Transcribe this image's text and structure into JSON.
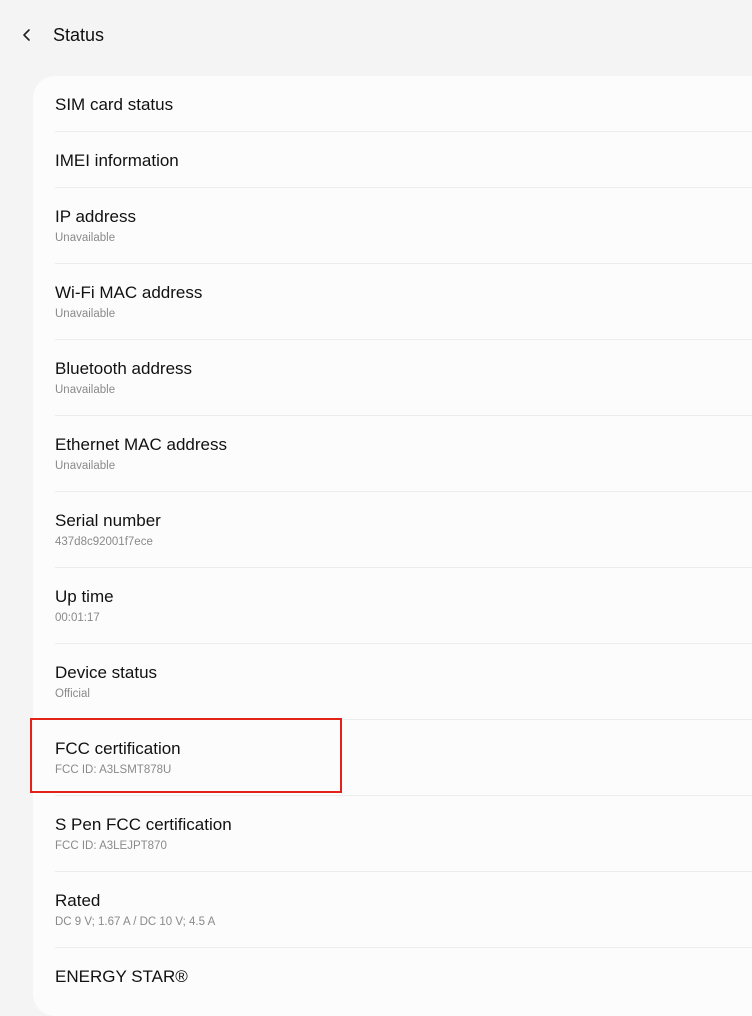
{
  "header": {
    "title": "Status"
  },
  "items": [
    {
      "label": "SIM card status",
      "sub": ""
    },
    {
      "label": "IMEI information",
      "sub": ""
    },
    {
      "label": "IP address",
      "sub": "Unavailable"
    },
    {
      "label": "Wi-Fi MAC address",
      "sub": "Unavailable"
    },
    {
      "label": "Bluetooth address",
      "sub": "Unavailable"
    },
    {
      "label": "Ethernet MAC address",
      "sub": "Unavailable"
    },
    {
      "label": "Serial number",
      "sub": "437d8c92001f7ece"
    },
    {
      "label": "Up time",
      "sub": "00:01:17"
    },
    {
      "label": "Device status",
      "sub": "Official"
    },
    {
      "label": "FCC certification",
      "sub": "FCC ID: A3LSMT878U"
    },
    {
      "label": "S Pen FCC certification",
      "sub": "FCC ID: A3LEJPT870"
    },
    {
      "label": "Rated",
      "sub": "DC 9 V; 1.67 A / DC 10 V; 4.5 A"
    },
    {
      "label": "ENERGY STAR®",
      "sub": ""
    }
  ],
  "colors": {
    "highlight": "#e2231a",
    "background": "#f4f4f4",
    "card": "#fcfcfc"
  },
  "icons": {
    "back": "chevron-left-icon"
  }
}
